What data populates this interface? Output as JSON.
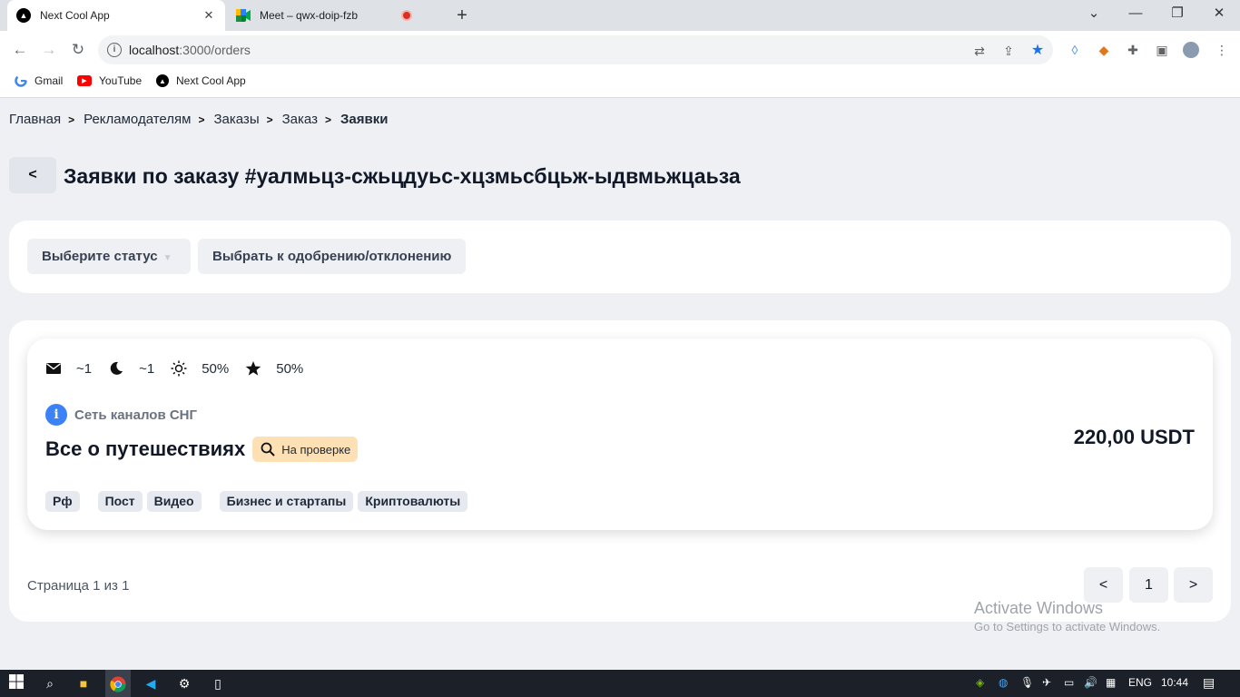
{
  "browser": {
    "tabs": [
      {
        "title": "Next Cool App"
      },
      {
        "title": "Meet – qwx-doip-fzb"
      }
    ],
    "url_host": "localhost",
    "url_path": ":3000/orders",
    "bookmarks": [
      {
        "label": "Gmail"
      },
      {
        "label": "YouTube"
      },
      {
        "label": "Next Cool App"
      }
    ]
  },
  "breadcrumbs": [
    "Главная",
    "Рекламодателям",
    "Заказы",
    "Заказ",
    "Заявки"
  ],
  "page_title": "Заявки по заказу #уалмьцз-сжьцдуьс-хцзмьсбцьж-ыдвмьжцаьза",
  "filters": {
    "status_placeholder": "Выберите статус",
    "select_button": "Выбрать к одобрению/отклонению"
  },
  "order": {
    "stats": {
      "mail": "~1",
      "night": "~1",
      "day": "50%",
      "rating": "50%"
    },
    "network": "Сеть каналов СНГ",
    "channel_name": "Все о путешествиях",
    "status": "На проверке",
    "price": "220,00 USDT",
    "tags": [
      "Рф",
      "Пост",
      "Видео",
      "Бизнес и стартапы",
      "Криптовалюты"
    ]
  },
  "pagination": {
    "text": "Страница 1 из 1",
    "prev": "<",
    "current": "1",
    "next": ">"
  },
  "watermark": {
    "line1": "Activate Windows",
    "line2": "Go to Settings to activate Windows."
  },
  "taskbar": {
    "lang": "ENG",
    "time": "10:44"
  },
  "colors": {
    "status_badge_bg": "#fde1b5",
    "info_blue": "#3b82f6",
    "page_bg": "#eef0f4"
  }
}
